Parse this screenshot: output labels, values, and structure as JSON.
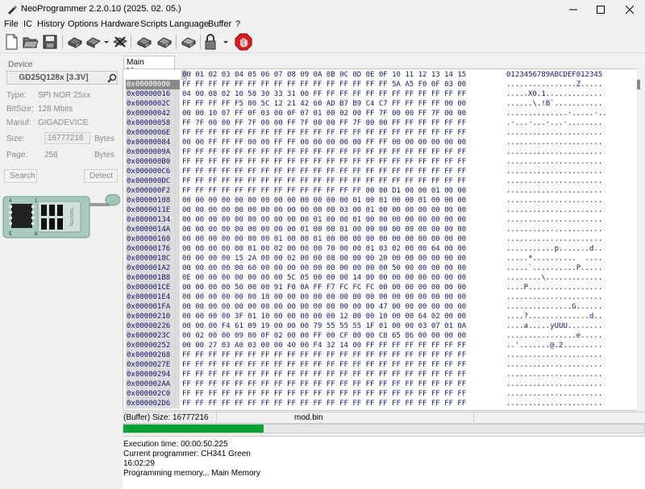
{
  "window": {
    "title": "NeoProgrammer 2.2.0.10 (2025. 02. 05.)"
  },
  "menu": [
    "File",
    "IC",
    "History",
    "Options",
    "Hardware",
    "Scripts",
    "Language",
    "Buffer",
    "?"
  ],
  "toolbar": {
    "icons": [
      "new-file-icon",
      "open-folder-icon",
      "save-icon",
      "read-chip-icon",
      "read-dropdown-icon",
      "verify-chip-icon",
      "erase-chip-icon",
      "write-chip-icon",
      "blank-check-icon",
      "protect-lock-icon",
      "lock-dropdown-icon",
      "stop-icon"
    ]
  },
  "device": {
    "section_label": "Device",
    "name": "GD25Q128x [3.3V]",
    "type_label": "Type:",
    "type_value": "SPI NOR 25xx",
    "bitsize_label": "BitSize:",
    "bitsize_value": "128 Mbits",
    "manuf_label": "Manuf:",
    "manuf_value": "GIGADEVICE",
    "size_label": "Size:",
    "size_value": "16777216",
    "size_unit": "Bytes",
    "page_label": "Page:",
    "page_value": "256",
    "page_unit": "Bytes",
    "search_button": "Search",
    "detect_button": "Detect"
  },
  "adapter": {
    "pin_labels": {
      "top_left": "4",
      "top_right": "1",
      "bottom_left": "5",
      "bottom_right": "8"
    },
    "body_text": "TEXTOOL"
  },
  "tab": {
    "label": "Memory"
  },
  "tab_label": "Main Memory",
  "hex": {
    "header_bytes": "00 01 02 03 04 05 06 07 08 09 0A 0B 0C 0D 0E 0F 10 11 12 13 14 15",
    "header_ascii": "0123456789ABCDEF012345",
    "selected_address": "0x00000000",
    "rows": [
      {
        "addr": "0x00000000",
        "bytes": "FF FF FF FF FF FF FF FF FF FF FF FF FF FF FF FF 5A A5 F0 0F 03 00",
        "ascii": "................Z....."
      },
      {
        "addr": "0x00000016",
        "bytes": "04 00 08 02 10 58 30 33 31 00 FF FF FF FF FF FF FF FF FF FF FF FF",
        "ascii": ".....X0.1............."
      },
      {
        "addr": "0x0000002C",
        "bytes": "FF FF FF FF F5 00 5C 12 21 42 60 AD B7 B9 C4 C7 FF FF FF FF 00 00",
        "ascii": "......\\.!B`..........."
      },
      {
        "addr": "0x00000042",
        "bytes": "00 00 10 07 FF 0F 03 00 0F 07 01 00 02 00 FF 7F 00 00 FF 7F 00 00",
        "ascii": "..............·.....·.."
      },
      {
        "addr": "0x00000058",
        "bytes": "FF 7F 00 00 FF 7F 00 00 FF 7F 00 00 FF 7F 00 00 FF FF FF FF FF FF",
        "ascii": ".·...·...·...·........"
      },
      {
        "addr": "0x0000006E",
        "bytes": "FF FF FF FF FF FF FF FF FF FF FF FF FF FF FF FF FF FF FF FF FF FF",
        "ascii": "......................"
      },
      {
        "addr": "0x00000084",
        "bytes": "00 00 FF FF FF 00 00 FF FF 00 00 00 00 00 FF FF 00 00 00 00 00 00",
        "ascii": "......................"
      },
      {
        "addr": "0x0000009A",
        "bytes": "FF FF FF FF FF FF FF FF FF FF FF FF FF FF FF FF FF FF FF FF FF FF",
        "ascii": "......................"
      },
      {
        "addr": "0x000000B0",
        "bytes": "FF FF FF FF FF FF FF FF FF FF FF FF FF FF FF FF FF FF FF FF FF FF",
        "ascii": "......................"
      },
      {
        "addr": "0x000000C6",
        "bytes": "FF FF FF FF FF FF FF FF FF FF FF FF FF FF FF FF FF FF FF FF FF FF",
        "ascii": "......................"
      },
      {
        "addr": "0x000000DC",
        "bytes": "FF FF FF FF FF FF FF FF FF FF FF FF FF FF FF FF FF FF FF FF FF FF",
        "ascii": "......................"
      },
      {
        "addr": "0x000000F2",
        "bytes": "FF FF FF FF FF FF FF FF FF FF FF FF FF FF 00 00 D1 00 00 01 00 00",
        "ascii": "......................"
      },
      {
        "addr": "0x00000108",
        "bytes": "00 00 00 00 00 00 00 00 00 00 00 00 00 01 00 01 00 00 01 00 00 00",
        "ascii": "......................"
      },
      {
        "addr": "0x0000011E",
        "bytes": "00 00 00 00 00 00 00 00 00 00 00 00 03 00 01 00 00 00 00 00 00 00",
        "ascii": "......................"
      },
      {
        "addr": "0x00000134",
        "bytes": "00 00 00 00 00 00 00 00 00 00 01 00 00 01 00 00 00 00 00 00 00 00",
        "ascii": "......................"
      },
      {
        "addr": "0x0000014A",
        "bytes": "00 00 00 00 00 00 00 00 00 01 00 00 01 00 00 00 00 00 00 00 00 00",
        "ascii": "......................"
      },
      {
        "addr": "0x00000160",
        "bytes": "00 00 00 00 00 00 00 01 00 00 01 00 00 00 00 00 00 00 00 00 00 00",
        "ascii": "......................"
      },
      {
        "addr": "0x00000176",
        "bytes": "00 00 00 00 00 01 00 02 00 00 00 70 00 00 01 03 02 00 00 64 00 00",
        "ascii": "...........p.......d.."
      },
      {
        "addr": "0x0000018C",
        "bytes": "00 00 00 00 15 2A 00 00 02 00 00 08 00 00 00 20 00 00 00 00 00 00",
        "ascii": ".....*..........  ...."
      },
      {
        "addr": "0x000001A2",
        "bytes": "00 00 00 00 00 60 00 00 00 00 00 00 00 00 00 00 50 00 00 00 00 00",
        "ascii": ".....`..........P....."
      },
      {
        "addr": "0x000001B8",
        "bytes": "0E 00 00 00 00 00 00 00 5C 05 00 00 00 14 00 00 00 00 00 00 00 00",
        "ascii": "........\\............."
      },
      {
        "addr": "0x000001CE",
        "bytes": "00 00 00 00 50 00 00 91 F0 0A FF F7 FC FC FC 00 00 00 00 00 00 00",
        "ascii": "....P................."
      },
      {
        "addr": "0x000001E4",
        "bytes": "00 00 00 00 00 00 18 00 00 00 00 00 00 00 00 00 00 00 00 00 00 00",
        "ascii": "......................"
      },
      {
        "addr": "0x000001FA",
        "bytes": "00 00 00 00 00 00 00 00 00 00 00 00 00 00 00 47 00 00 00 00 00 00",
        "ascii": "...............G......"
      },
      {
        "addr": "0x00000210",
        "bytes": "00 00 00 00 3F 01 10 00 00 00 00 00 12 00 00 10 00 00 64 02 00 00",
        "ascii": "....?..............d.."
      },
      {
        "addr": "0x00000226",
        "bytes": "00 00 00 F4 61 09 19 00 00 00 79 55 55 55 1F 01 00 00 03 07 01 0A",
        "ascii": "....a.....yUUU........"
      },
      {
        "addr": "0x0000023C",
        "bytes": "00 02 00 00 09 00 0F 02 00 00 FF 00 CF 00 00 C8 65 86 00 00 00 00",
        "ascii": "................e....."
      },
      {
        "addr": "0x00000252",
        "bytes": "00 00 27 03 A0 03 00 00 40 00 F4 32 14 00 FF FF FF FF FF FF FF FF",
        "ascii": "..'.......@.2........."
      },
      {
        "addr": "0x00000268",
        "bytes": "FF FF FF FF FF FF FF FF FF FF FF FF FF FF FF FF FF FF FF FF FF FF",
        "ascii": "......................"
      },
      {
        "addr": "0x0000027E",
        "bytes": "FF FF FF FF FF FF FF FF FF FF FF FF FF FF FF FF FF FF FF FF FF FF",
        "ascii": "......................"
      },
      {
        "addr": "0x00000294",
        "bytes": "FF FF FF FF FF FF FF FF FF FF FF FF FF FF FF FF FF FF FF FF FF FF",
        "ascii": "......................"
      },
      {
        "addr": "0x000002AA",
        "bytes": "FF FF FF FF FF FF FF FF FF FF FF FF FF FF FF FF FF FF FF FF FF FF",
        "ascii": "......................"
      },
      {
        "addr": "0x000002C0",
        "bytes": "FF FF FF FF FF FF FF FF FF FF FF FF FF FF FF FF FF FF FF FF FF FF",
        "ascii": "......................"
      },
      {
        "addr": "0x000002D6",
        "bytes": "FF FF FF FF FF FF FF FF FF FF FF FF FF FF FF FF FF FF FF FF FF FF",
        "ascii": "......................"
      }
    ]
  },
  "status": {
    "buffer_size": "(Buffer) Size: 16777216",
    "file": "mod.bin",
    "progress": 0.27,
    "progress_color": "#08a332"
  },
  "log": [
    "Execution time: 00:00:50.225",
    "Current programmer: CH341 Green",
    "16:02:29",
    "Programming memory... Main Memory"
  ]
}
